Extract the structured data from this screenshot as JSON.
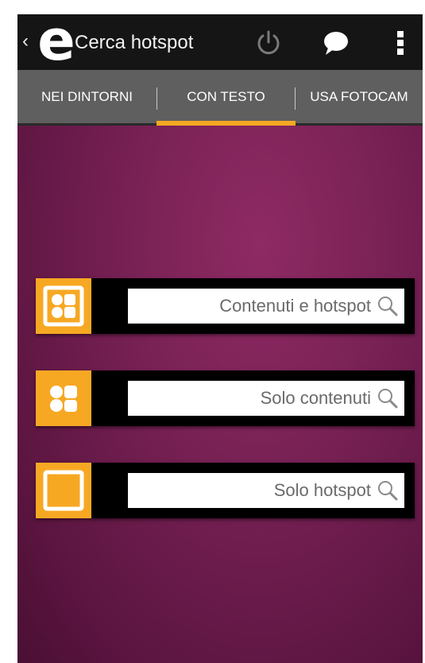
{
  "actionbar": {
    "back_glyph": "‹",
    "logo_letter": "e",
    "title": "Cerca hotspot",
    "icons": [
      "power-icon",
      "chat-icon",
      "overflow-menu-icon"
    ]
  },
  "tabs": [
    {
      "label": "NEI DINTORNI",
      "selected": false
    },
    {
      "label": "CON TESTO",
      "selected": true
    },
    {
      "label": "USA FOTOCAM",
      "selected": false
    }
  ],
  "search_rows": [
    {
      "label": "Contenuti e hotspot",
      "icon": "contents-and-hotspot-icon"
    },
    {
      "label": "Solo contenuti",
      "icon": "contents-only-icon"
    },
    {
      "label": "Solo hotspot",
      "icon": "hotspot-only-icon"
    }
  ],
  "colors": {
    "accent": "#f7a823",
    "actionbar": "#151515",
    "tabbar": "#5f5f5f",
    "background": "#7a2256"
  }
}
